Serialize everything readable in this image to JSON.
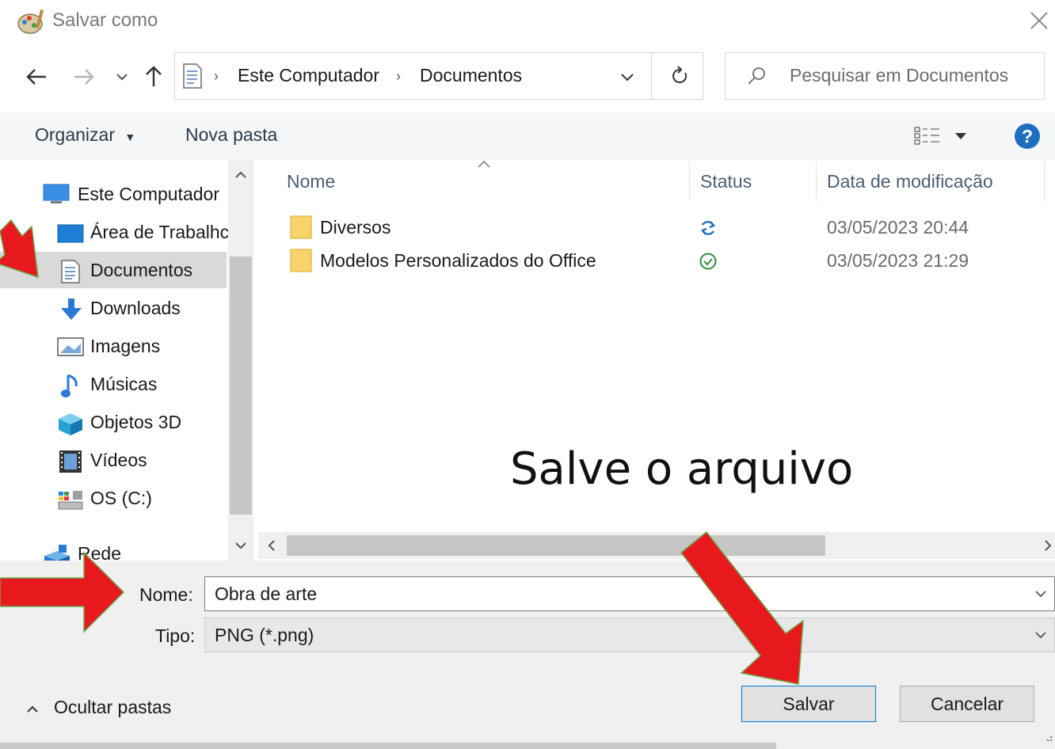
{
  "window": {
    "title": "Salvar como",
    "icon": "paint-app-icon"
  },
  "address": {
    "root_icon": "documents-icon",
    "crumbs": [
      "Este Computador",
      "Documentos"
    ],
    "search_placeholder": "Pesquisar em Documentos"
  },
  "toolbar": {
    "organize_label": "Organizar",
    "new_folder_label": "Nova pasta"
  },
  "sidebar": {
    "items": [
      {
        "label": "Este Computador",
        "icon": "computer-icon"
      },
      {
        "label": "Área de Trabalhc",
        "icon": "desktop-icon"
      },
      {
        "label": "Documentos",
        "icon": "documents-icon"
      },
      {
        "label": "Downloads",
        "icon": "downloads-icon"
      },
      {
        "label": "Imagens",
        "icon": "pictures-icon"
      },
      {
        "label": "Músicas",
        "icon": "music-icon"
      },
      {
        "label": "Objetos 3D",
        "icon": "objects-3d-icon"
      },
      {
        "label": "Vídeos",
        "icon": "videos-icon"
      },
      {
        "label": "OS (C:)",
        "icon": "drive-icon"
      },
      {
        "label": "Rede",
        "icon": "network-icon"
      }
    ]
  },
  "files": {
    "columns": [
      "Nome",
      "Status",
      "Data de modificação"
    ],
    "rows": [
      {
        "name": "Diversos",
        "status": "sync-icon",
        "date": "03/05/2023 20:44"
      },
      {
        "name": "Modelos Personalizados do Office",
        "status": "synced-check-icon",
        "date": "03/05/2023 21:29"
      }
    ]
  },
  "form": {
    "name_label": "Nome:",
    "name_value": "Obra de arte",
    "type_label": "Tipo:",
    "type_value": "PNG (*.png)"
  },
  "buttons": {
    "save": "Salvar",
    "cancel": "Cancelar",
    "hide_folders": "Ocultar pastas"
  },
  "annotation": {
    "text": "Salve o arquivo",
    "arrow_color": "#e8191c",
    "arrow_outline": "#6aa84f"
  },
  "colors": {
    "help": "#1f6fbf",
    "selection": "#d9d9d9",
    "sync": "#1f6fbf",
    "synced": "#2e8b3e"
  }
}
